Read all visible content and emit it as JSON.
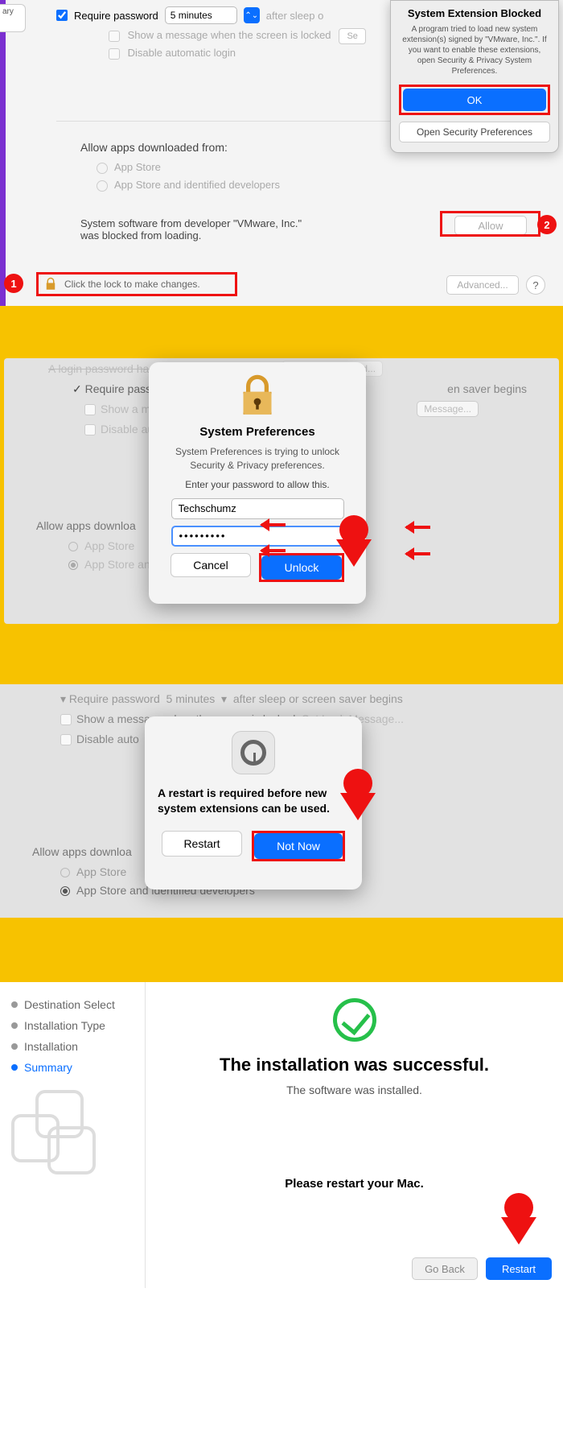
{
  "panel1": {
    "sidebar_fragment": "ary",
    "require_password_label": "Require password",
    "require_password_value": "5 minutes",
    "require_password_suffix": "after sleep o",
    "show_message": "Show a message when the screen is locked",
    "set_msg_btn": "Se",
    "disable_autologin": "Disable automatic login",
    "allow_heading": "Allow apps downloaded from:",
    "radio_appstore": "App Store",
    "radio_identified": "App Store and identified developers",
    "blocked_note": "System software from developer \"VMware, Inc.\" was blocked from loading.",
    "allow_btn": "Allow",
    "lock_note": "Click the lock to make changes.",
    "advanced_btn": "Advanced...",
    "help_btn": "?",
    "badge1": "1",
    "badge2": "2",
    "popup": {
      "title": "System Extension Blocked",
      "body": "A program tried to load new system extension(s) signed by \"VMware, Inc.\". If you want to enable these extensions, open Security & Privacy System Preferences.",
      "ok": "OK",
      "open_pref": "Open Security Preferences"
    }
  },
  "panel2": {
    "bg_top_cut": "A login password has been set for this user",
    "bg_changepw": "Change Password...",
    "bg_require": "Require pass",
    "bg_require_end": "en saver begins",
    "bg_showmsg": "Show a mes",
    "bg_msgbtn": "Message...",
    "bg_disable": "Disable auto",
    "bg_allow": "Allow apps downloa",
    "bg_appstore": "App Store",
    "bg_identified": "App Store an",
    "dialog": {
      "title": "System Preferences",
      "msg": "System Preferences is trying to unlock Security & Privacy preferences.",
      "prompt": "Enter your password to allow this.",
      "username": "Techschumz",
      "password_mask": "•••••••••",
      "cancel": "Cancel",
      "unlock": "Unlock"
    }
  },
  "panel3": {
    "bg_require": "Require password",
    "bg_require_val": "5 minutes",
    "bg_require_end": "after sleep or screen saver begins",
    "bg_showmsg": "Show a message when the screen is locked",
    "bg_setlock": "Set Lock Message...",
    "bg_disable": "Disable auto",
    "bg_allow": "Allow apps downloa",
    "bg_appstore": "App Store",
    "bg_identified": "App Store and identified developers",
    "dialog": {
      "msg": "A restart is required before new system extensions can be used.",
      "restart": "Restart",
      "notnow": "Not Now"
    }
  },
  "panel4": {
    "steps": {
      "dest": "Destination Select",
      "type": "Installation Type",
      "inst": "Installation",
      "summary": "Summary"
    },
    "heading": "The installation was successful.",
    "sub": "The software was installed.",
    "restart_prompt": "Please restart your Mac.",
    "goback": "Go Back",
    "restart": "Restart"
  }
}
